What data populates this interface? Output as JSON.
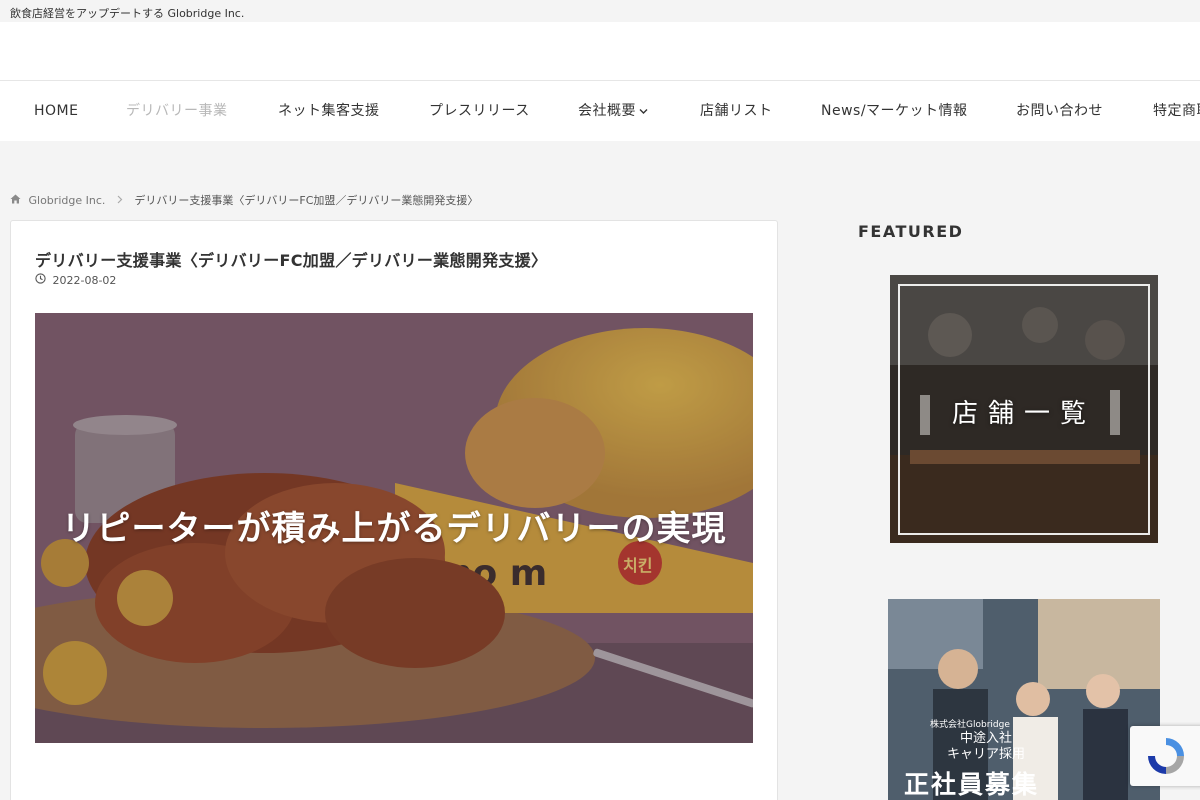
{
  "topbar": {
    "tagline": "飲食店経営をアップデートする Globridge Inc."
  },
  "nav": {
    "items": [
      "HOME",
      "デリバリー事業",
      "ネット集客支援",
      "プレスリリース",
      "会社概要",
      "店舗リスト",
      "News/マーケット情報",
      "お問い合わせ",
      "特定商取引法"
    ],
    "active_index": 1
  },
  "breadcrumb": {
    "home": "Globridge Inc.",
    "current": "デリバリー支援事業〈デリバリーFC加盟／デリバリー業態開発支援〉"
  },
  "article": {
    "title": "デリバリー支援事業〈デリバリーFC加盟／デリバリー業態開発支援〉",
    "date": "2022-08-02",
    "hero_caption": "リピーターが積み上がるデリバリーの実現",
    "hero_signage": "mo m",
    "hero_badge": "치킨"
  },
  "sidebar": {
    "featured_title": "FEATURED",
    "card1": {
      "caption": "店舗一覧"
    },
    "card2": {
      "company": "株式会社Globridge",
      "line1": "中途入社",
      "line2": "キャリア採用",
      "main": "正社員募集"
    }
  },
  "colors": {
    "nav_active": "#b8b8b8",
    "hero_overlay": "#7b5d6a",
    "text": "#333333"
  }
}
